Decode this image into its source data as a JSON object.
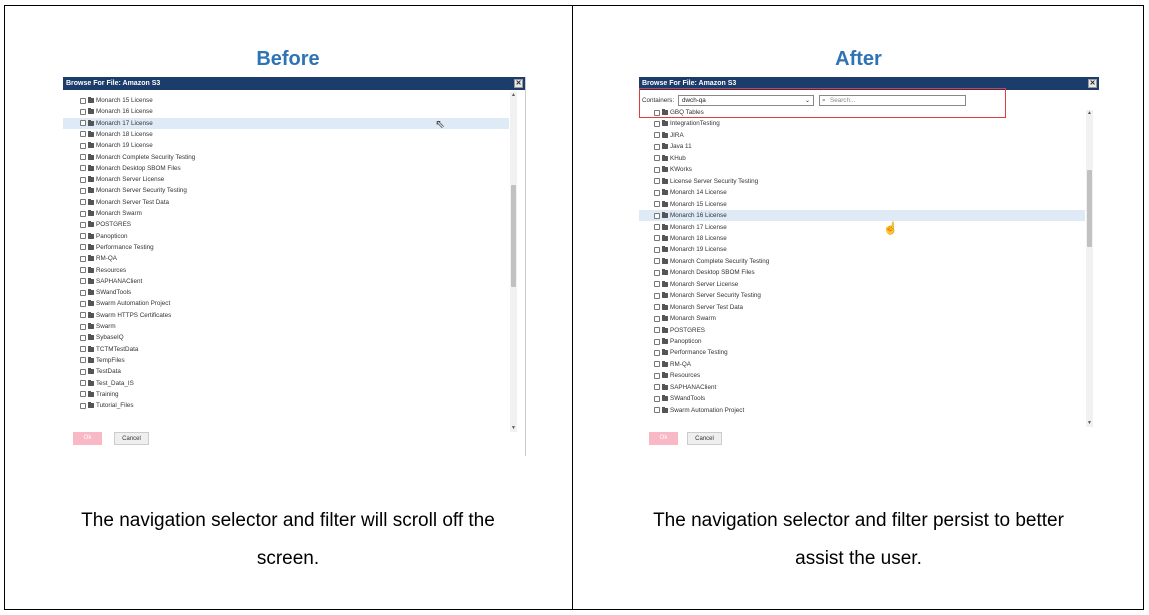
{
  "before": {
    "heading": "Before",
    "caption_lines": [
      "The navigation selector and filter will scroll off the",
      "screen."
    ],
    "dialog": {
      "title": "Browse For File: Amazon S3",
      "close_glyph": "✕",
      "selected_index": 2,
      "items": [
        "Monarch 15 License",
        "Monarch 16 License",
        "Monarch 17 License",
        "Monarch 18 License",
        "Monarch 19 License",
        "Monarch Complete Security Testing",
        "Monarch Desktop SBOM Files",
        "Monarch Server License",
        "Monarch Server Security Testing",
        "Monarch Server Test Data",
        "Monarch Swarm",
        "POSTGRES",
        "Panopticon",
        "Performance Testing",
        "RM-QA",
        "Resources",
        "SAPHANAClient",
        "SWandTools",
        "Swarm Automation Project",
        "Swarm HTTPS Certificates",
        "Swarm",
        "SybaseIQ",
        "TCTMTestData",
        "TempFiles",
        "TestData",
        "Test_Data_IS",
        "Training",
        "Tutorial_Files"
      ],
      "ok_label": "Ok",
      "cancel_label": "Cancel"
    }
  },
  "after": {
    "heading": "After",
    "caption_lines": [
      "The navigation selector and filter persist to better",
      "assist the user."
    ],
    "dialog": {
      "title": "Browse For File: Amazon S3",
      "close_glyph": "✕",
      "containers_label": "Containers:",
      "container_value": "dwch-qa",
      "search_placeholder": "Search...",
      "selected_index": 9,
      "items": [
        "GBQ Tables",
        "IntegrationTesting",
        "JIRA",
        "Java 11",
        "KHub",
        "KWorks",
        "License Server Security Testing",
        "Monarch 14 License",
        "Monarch 15 License",
        "Monarch 16 License",
        "Monarch 17 License",
        "Monarch 18 License",
        "Monarch 19 License",
        "Monarch Complete Security Testing",
        "Monarch Desktop SBOM Files",
        "Monarch Server License",
        "Monarch Server Security Testing",
        "Monarch Server Test Data",
        "Monarch Swarm",
        "POSTGRES",
        "Panopticon",
        "Performance Testing",
        "RM-QA",
        "Resources",
        "SAPHANAClient",
        "SWandTools",
        "Swarm Automation Project"
      ],
      "ok_label": "Ok",
      "cancel_label": "Cancel"
    }
  },
  "icons": {
    "item_icons": [
      "checkbox-icon",
      "folder-icon"
    ],
    "cursor_before": "arrow-cursor-icon",
    "cursor_after": "hand-cursor-icon"
  },
  "colors": {
    "heading": "#2e74b5",
    "titlebar": "#1c3d6b",
    "selected_row": "#deeaf6",
    "ok_button": "#f9b8c6",
    "highlight_border": "#e03c3c"
  }
}
